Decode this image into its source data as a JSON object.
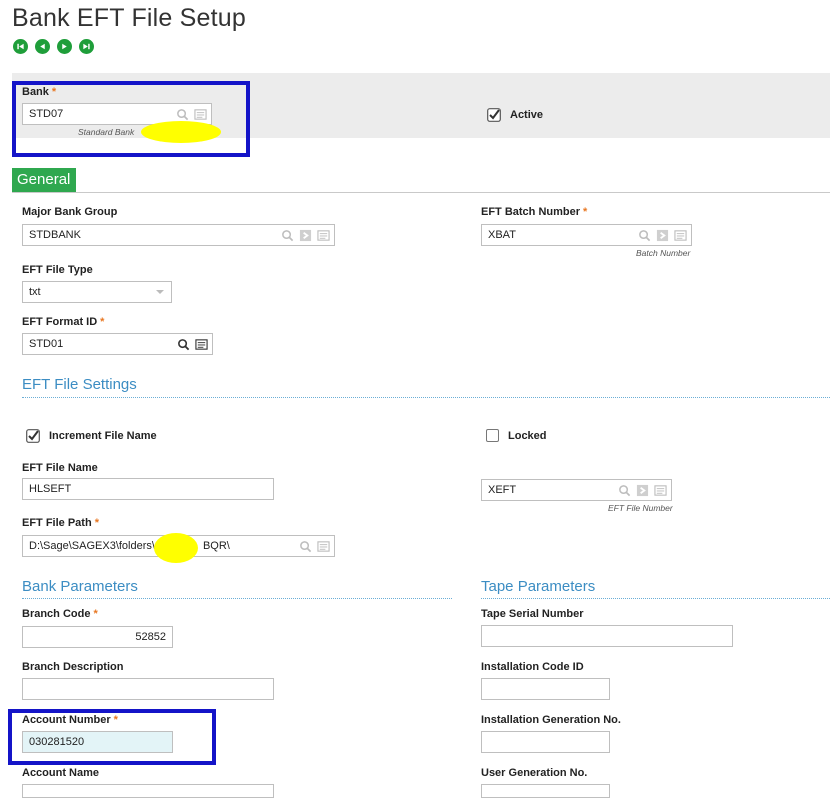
{
  "page": {
    "title": "Bank EFT File Setup"
  },
  "nav": {
    "first": "first-record-icon",
    "previous": "previous-record-icon",
    "next": "next-record-icon",
    "last": "last-record-icon"
  },
  "header": {
    "bank": {
      "label": "Bank",
      "value": "STD07",
      "description": "Standard Bank"
    },
    "active": {
      "label": "Active",
      "checked": true
    }
  },
  "tabs": [
    {
      "label": "General",
      "active": true
    }
  ],
  "general": {
    "major_bank_group": {
      "label": "Major Bank Group",
      "value": "STDBANK"
    },
    "eft_batch_number": {
      "label": "EFT Batch Number",
      "value": "XBAT",
      "description": "Batch Number"
    },
    "eft_file_type": {
      "label": "EFT File Type",
      "value": "txt"
    },
    "eft_format_id": {
      "label": "EFT Format ID",
      "value": "STD01"
    }
  },
  "eft_file_settings": {
    "title": "EFT File Settings",
    "increment_file_name": {
      "label": "Increment File Name",
      "checked": true
    },
    "locked": {
      "label": "Locked",
      "checked": false
    },
    "eft_file_name": {
      "label": "EFT File Name",
      "value": "HLSEFT"
    },
    "eft_file_number": {
      "value": "XEFT",
      "description": "EFT File Number"
    },
    "eft_file_path": {
      "label": "EFT File Path",
      "value_start": "D:\\Sage\\SAGEX3\\folders\\",
      "value_end": "BQR\\"
    }
  },
  "bank_parameters": {
    "title": "Bank Parameters",
    "branch_code": {
      "label": "Branch Code",
      "value": "52852"
    },
    "branch_description": {
      "label": "Branch Description",
      "value": ""
    },
    "account_number": {
      "label": "Account Number",
      "value": "030281520"
    },
    "account_name": {
      "label": "Account Name",
      "value": ""
    }
  },
  "tape_parameters": {
    "title": "Tape Parameters",
    "tape_serial_number": {
      "label": "Tape Serial Number",
      "value": ""
    },
    "installation_code_id": {
      "label": "Installation Code ID",
      "value": ""
    },
    "installation_generation_no": {
      "label": "Installation Generation No.",
      "value": ""
    },
    "user_generation_no": {
      "label": "User Generation No.",
      "value": ""
    }
  },
  "required_marker": "*",
  "colors": {
    "accent_green": "#2fa84f",
    "section_blue": "#3c8dc3",
    "required_orange": "#e87722",
    "highlight_box": "#1414c8",
    "redaction_yellow": "#ffff00"
  }
}
